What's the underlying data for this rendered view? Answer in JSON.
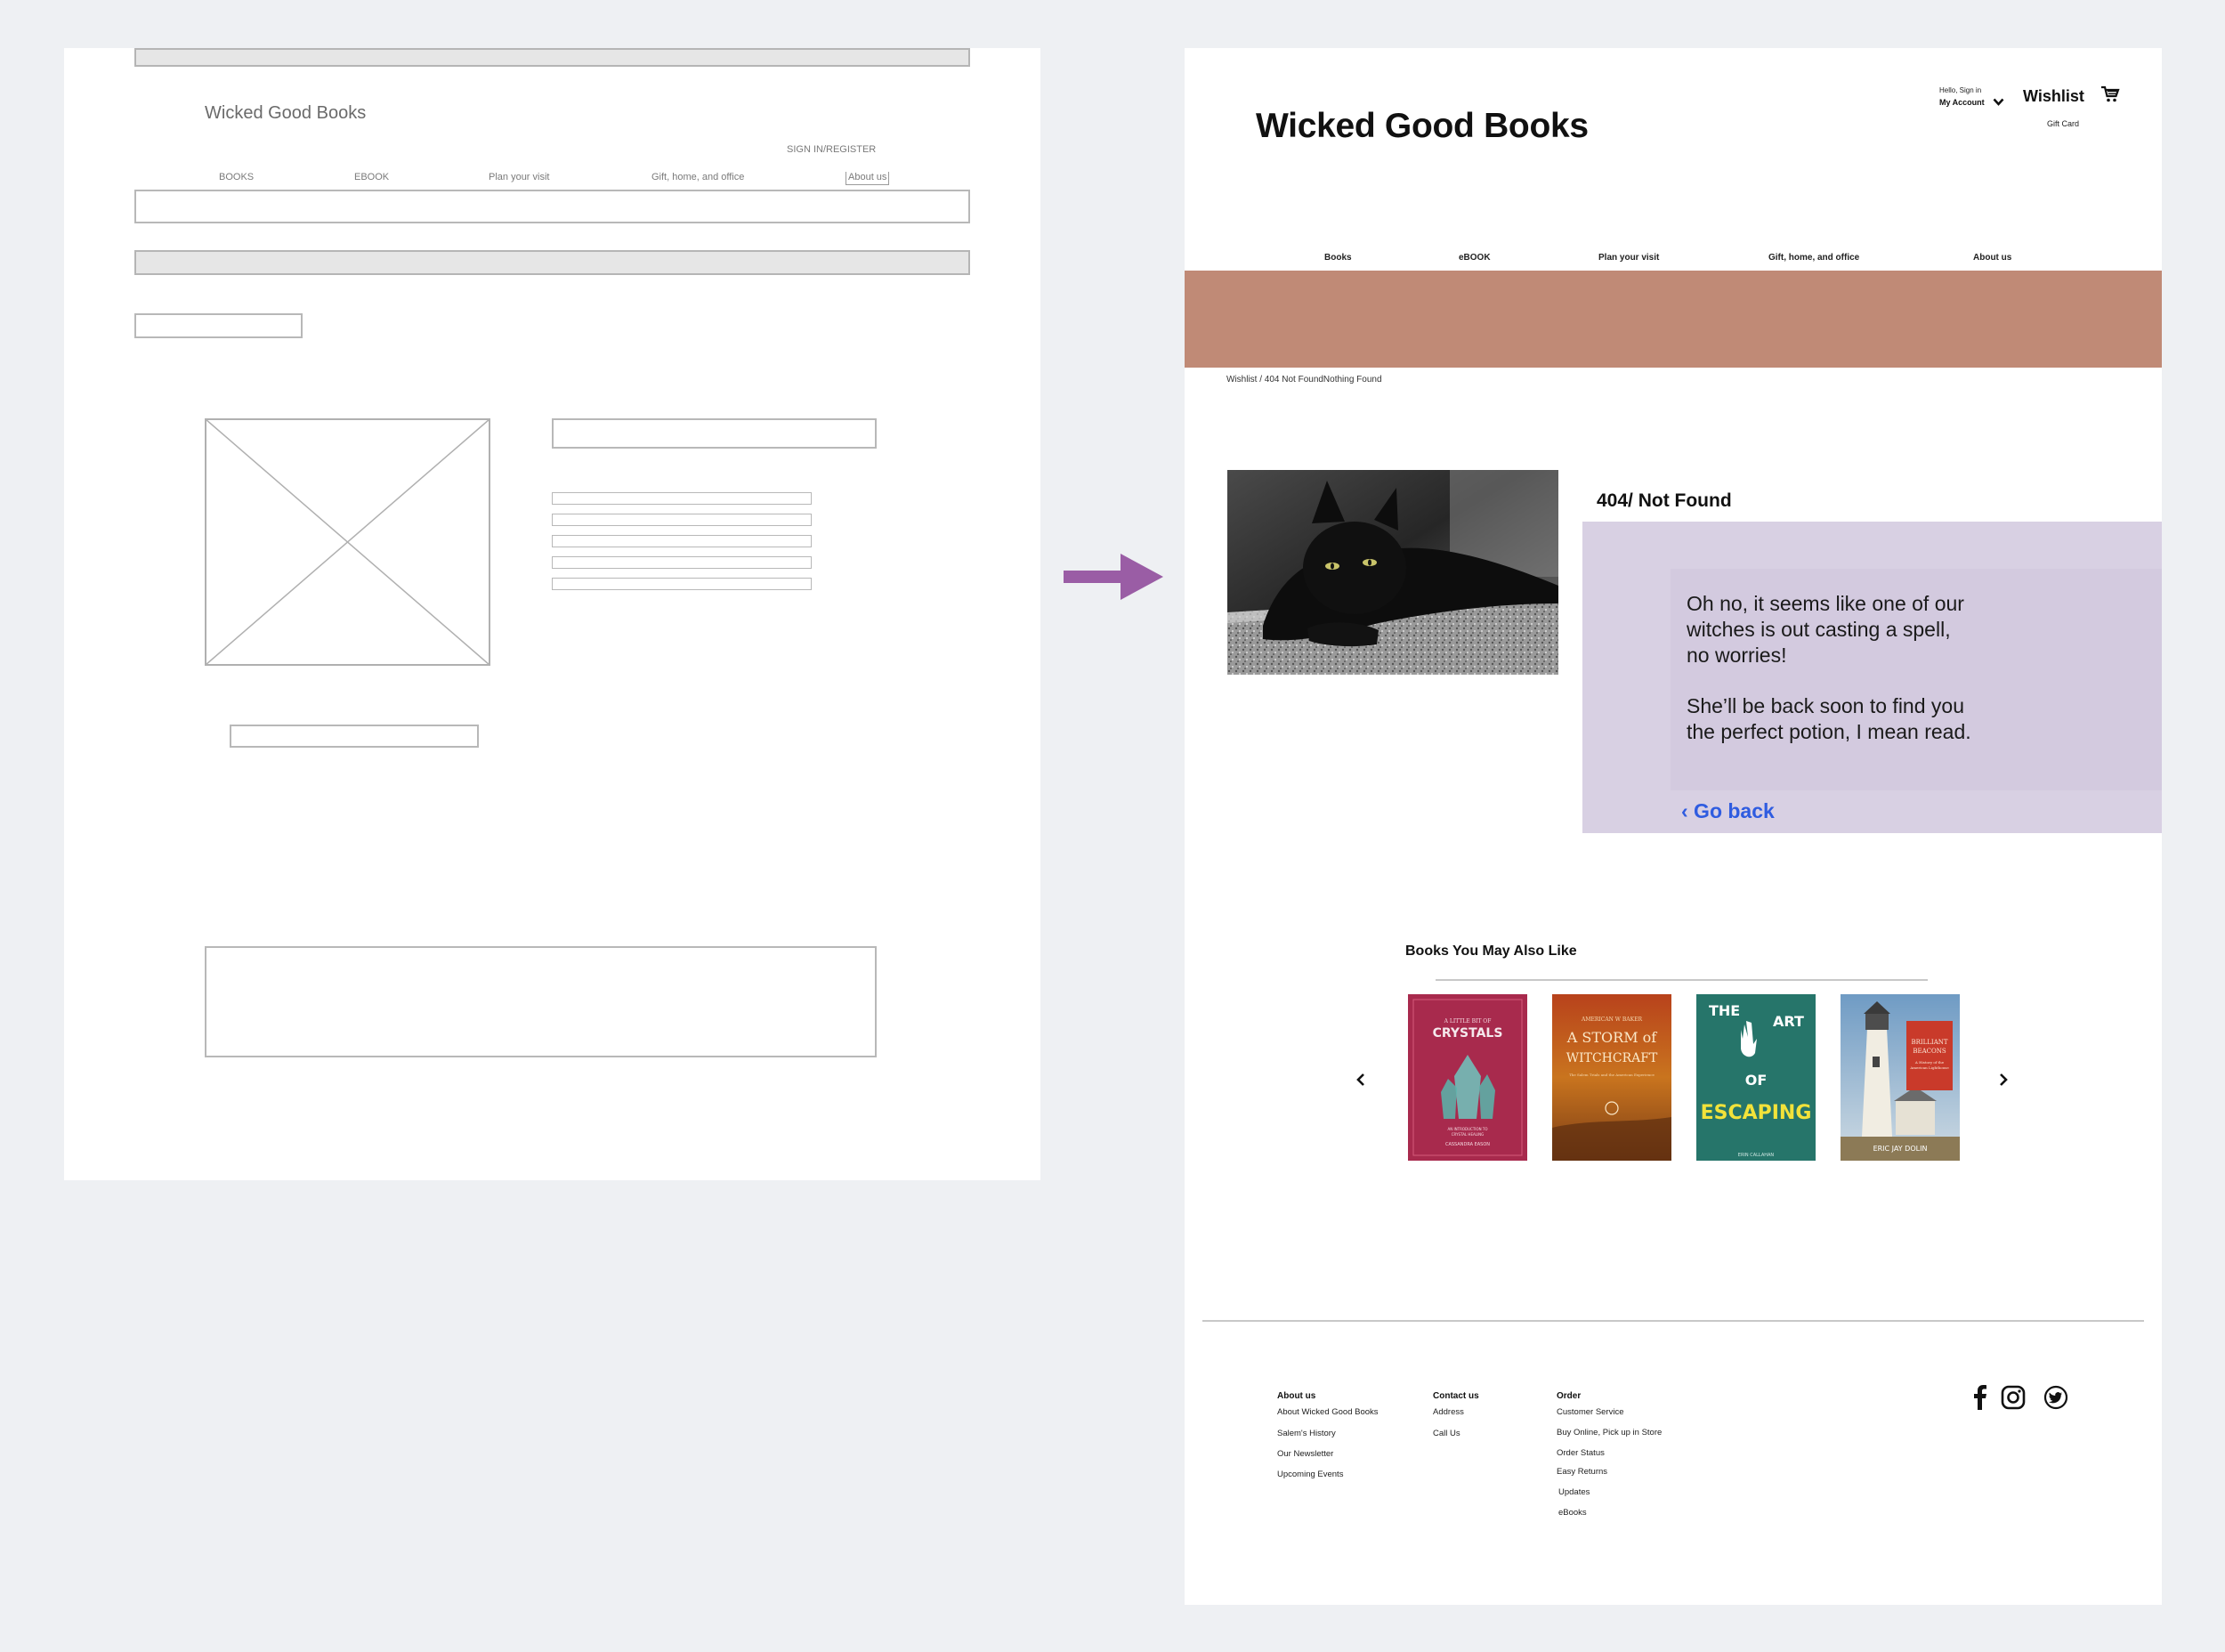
{
  "wireframe": {
    "title": "Wicked Good Books",
    "sign_in": "SIGN IN/REGISTER",
    "nav": [
      "BOOKS",
      "EBOOK",
      "Plan your visit",
      "Gift, home, and office",
      "About us"
    ]
  },
  "site": {
    "title": "Wicked Good Books",
    "account": {
      "hello": "Hello, Sign in",
      "my_account": "My Account"
    },
    "wishlist": "Wishlist",
    "gift_card": "Gift Card",
    "nav": [
      "Books",
      "eBOOK",
      "Plan your visit",
      "Gift, home, and office",
      "About us"
    ],
    "breadcrumb": "Wishlist / 404  Not FoundNothing Found",
    "hero_color": "#c08a76"
  },
  "not_found": {
    "title": "404/ Not Found",
    "message_1": [
      "Oh no, it seems like one of our",
      "witches is out casting a spell,",
      "no worries!"
    ],
    "message_2": [
      "She’ll be back soon to find you",
      "the perfect potion, I mean read."
    ],
    "go_back": "‹ Go back"
  },
  "recommendations": {
    "title": "Books You May Also Like",
    "books": [
      {
        "lines": [
          "A LITTLE BIT OF",
          "CRYSTALS",
          "AN INTRODUCTION TO",
          "CRYSTAL HEALING",
          "CASSANDRA EASON"
        ]
      },
      {
        "lines": [
          "AMERICAN W BAKER",
          "A STORM of",
          "WITCHCRAFT",
          "The Salem Trials and the American Experience"
        ]
      },
      {
        "lines": [
          "THE",
          "ART",
          "OF",
          "ESCAPING",
          "ERIN CALLAHAN"
        ]
      },
      {
        "lines": [
          "BRILLIANT",
          "BEACONS",
          "A History of the",
          "American Lighthouse",
          "ERIC JAY DOLIN"
        ]
      }
    ]
  },
  "footer": {
    "about": {
      "heading": "About us",
      "links": [
        "About Wicked Good Books",
        "Salem's History",
        "Our Newsletter",
        "Upcoming Events"
      ]
    },
    "contact": {
      "heading": "Contact us",
      "links": [
        "Address",
        "Call Us"
      ]
    },
    "order": {
      "heading": "Order",
      "links": [
        "Customer Service",
        "Buy Online, Pick up in Store",
        "Order Status",
        "Easy Returns",
        "Updates",
        "eBooks"
      ]
    },
    "social": [
      "facebook-icon",
      "instagram-icon",
      "twitter-icon"
    ]
  }
}
